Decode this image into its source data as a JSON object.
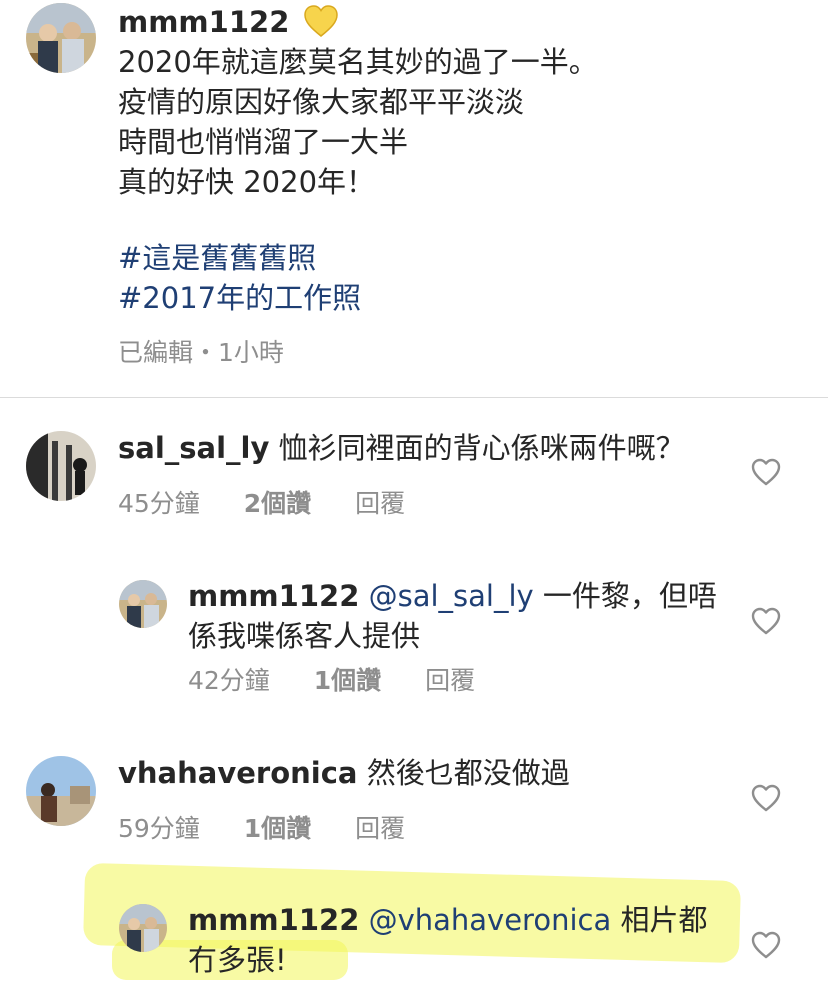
{
  "caption": {
    "username": "mmm1122",
    "emoji": "💛",
    "lines": [
      "2020年就這麼莫名其妙的過了一半。",
      "疫情的原因好像大家都平平淡淡",
      "時間也悄悄溜了一大半",
      "真的好快 2020年！"
    ],
    "hashtags": [
      "#這是舊舊舊照",
      "#2017年的工作照"
    ],
    "meta": "已編輯・1小時"
  },
  "comments": [
    {
      "username": "sal_sal_ly",
      "text": "恤衫同裡面的背心係咪兩件嘅？",
      "time": "45分鐘",
      "likes": "2個讚",
      "reply": "回覆"
    },
    {
      "username": "mmm1122",
      "mention": "@sal_sal_ly",
      "text_line1": "一件黎，但唔",
      "text_line2": "係我喋係客人提供",
      "time": "42分鐘",
      "likes": "1個讚",
      "reply": "回覆"
    },
    {
      "username": "vhahaveronica",
      "text": "然後乜都没做過",
      "time": "59分鐘",
      "likes": "1個讚",
      "reply": "回覆"
    },
    {
      "username": "mmm1122",
      "mention": "@vhahaveronica",
      "text_line1": "相片都",
      "text_line2": "冇多張!"
    }
  ],
  "colors": {
    "link": "#1f3f74",
    "meta": "#8e8e8e",
    "highlight": "#f3f55a"
  },
  "icons": [
    "heart-outline-icon"
  ]
}
